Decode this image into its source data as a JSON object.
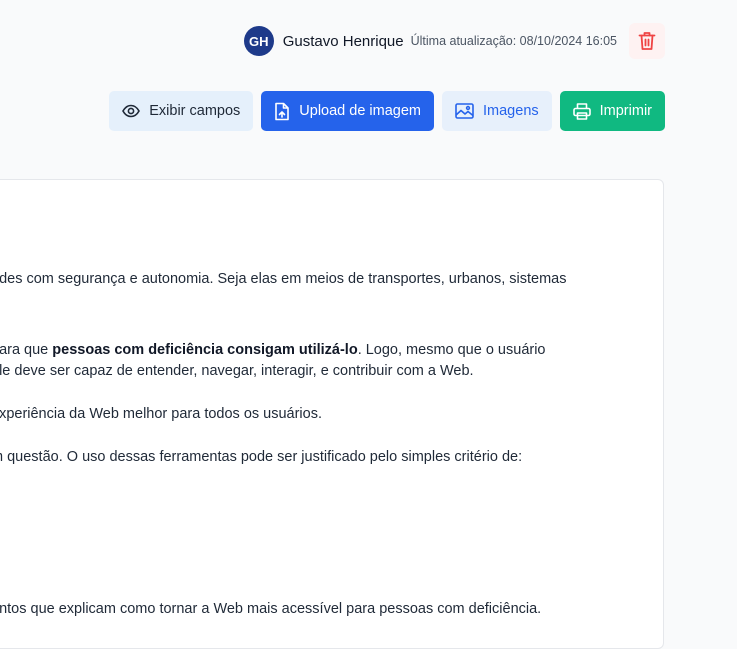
{
  "meta": {
    "avatar_initials": "GH",
    "author": "Gustavo Henrique",
    "updated": "Última atualização: 08/10/2024 16:05",
    "delete_icon": "trash-icon"
  },
  "toolbar": {
    "show_fields": "Exibir campos",
    "upload": "Upload de imagem",
    "images": "Imagens",
    "print": "Imprimir"
  },
  "content": {
    "p1": "ades com segurança e autonomia. Seja elas em meios de transportes, urbanos, sistemas",
    "p2_a": "para que ",
    "p2_b": "pessoas com deficiência consigam utilizá-lo",
    "p2_c": ". Logo, mesmo que o usuário",
    "p2_line2": "ele deve ser capaz de entender, navegar, interagir, e contribuir com a Web.",
    "p3": "experiência da Web melhor para todos os usuários.",
    "p4": "m questão. O uso dessas ferramentas pode ser justificado pelo simples critério de:",
    "p5": "entos que explicam como tornar a Web mais acessível para pessoas com deficiência."
  },
  "colors": {
    "primary": "#2563eb",
    "success": "#10b981",
    "danger": "#ef4444",
    "avatar": "#1e3a8a"
  }
}
